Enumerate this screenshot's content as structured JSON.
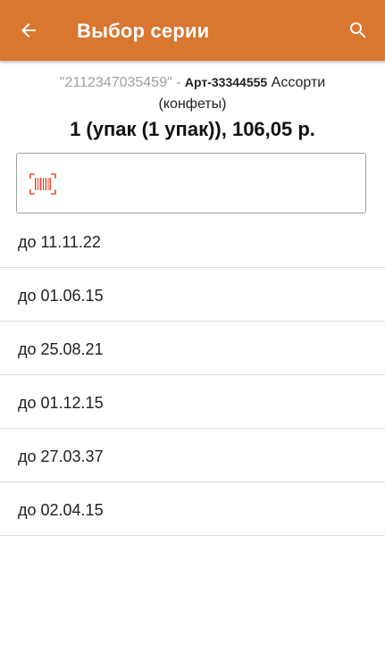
{
  "header": {
    "title": "Выбор серии",
    "back_icon": "arrow-left-icon",
    "search_icon": "search-icon",
    "color": "#d9762f"
  },
  "product": {
    "barcode": "\"2112347035459\"",
    "separator": "-",
    "article": "Арт-33344555",
    "name_line1": "Ассорти",
    "name_line2": "(конфеты)",
    "quantity_price": "1 (упак (1 упак)), 106,05 р."
  },
  "scan_field": {
    "icon": "barcode-scanner-icon",
    "value": ""
  },
  "series": [
    {
      "label": "до 11.11.22"
    },
    {
      "label": "до 01.06.15"
    },
    {
      "label": "до 25.08.21"
    },
    {
      "label": "до 01.12.15"
    },
    {
      "label": "до 27.03.37"
    },
    {
      "label": "до 02.04.15"
    }
  ]
}
